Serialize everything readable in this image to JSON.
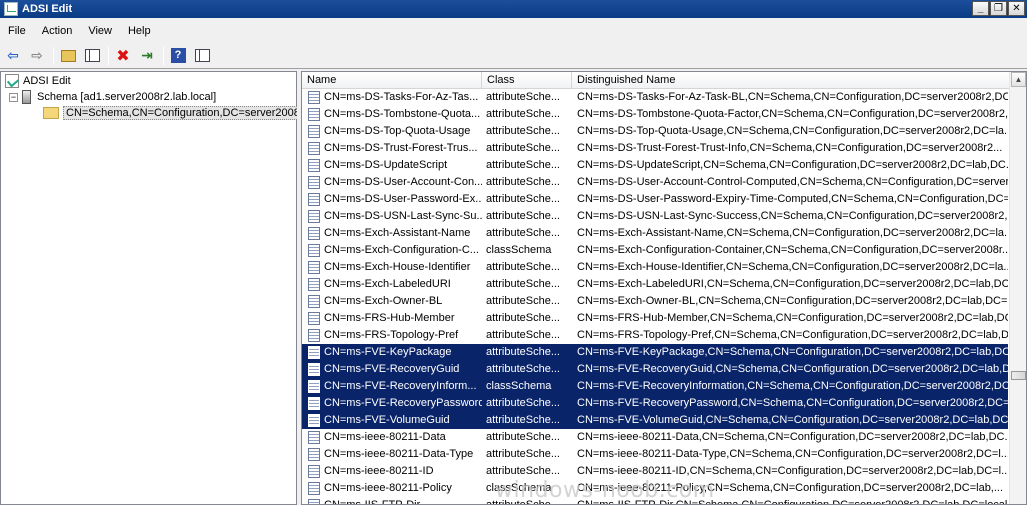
{
  "window": {
    "title": "ADSI Edit",
    "controls": {
      "minimize": "_",
      "restore": "❐",
      "close": "✕"
    }
  },
  "menu": [
    "File",
    "Action",
    "View",
    "Help"
  ],
  "toolbar": [
    {
      "name": "back-arrow-icon",
      "glyph": "⇦"
    },
    {
      "name": "forward-arrow-icon",
      "glyph": "⇨"
    },
    {
      "name": "up-folder-icon",
      "glyph": ""
    },
    {
      "name": "show-hide-tree-icon",
      "glyph": ""
    },
    {
      "name": "delete-icon",
      "glyph": "✖"
    },
    {
      "name": "export-icon",
      "glyph": "⇥"
    },
    {
      "name": "help-icon",
      "glyph": "?"
    },
    {
      "name": "properties-icon",
      "glyph": ""
    }
  ],
  "tree": {
    "root": "ADSI Edit",
    "schema_node": "Schema [ad1.server2008r2.lab.local]",
    "expander": "−",
    "selected_node": "CN=Schema,CN=Configuration,DC=server2008"
  },
  "list": {
    "columns": [
      "Name",
      "Class",
      "Distinguished Name"
    ],
    "rows": [
      {
        "name": "CN=ms-DS-Tasks-For-Az-Tas...",
        "class": "attributeSche...",
        "dn": "CN=ms-DS-Tasks-For-Az-Task-BL,CN=Schema,CN=Configuration,DC=server2008r2,DC...",
        "selected": false
      },
      {
        "name": "CN=ms-DS-Tombstone-Quota...",
        "class": "attributeSche...",
        "dn": "CN=ms-DS-Tombstone-Quota-Factor,CN=Schema,CN=Configuration,DC=server2008r2,D...",
        "selected": false
      },
      {
        "name": "CN=ms-DS-Top-Quota-Usage",
        "class": "attributeSche...",
        "dn": "CN=ms-DS-Top-Quota-Usage,CN=Schema,CN=Configuration,DC=server2008r2,DC=la...",
        "selected": false
      },
      {
        "name": "CN=ms-DS-Trust-Forest-Trus...",
        "class": "attributeSche...",
        "dn": "CN=ms-DS-Trust-Forest-Trust-Info,CN=Schema,CN=Configuration,DC=server2008r2...",
        "selected": false
      },
      {
        "name": "CN=ms-DS-UpdateScript",
        "class": "attributeSche...",
        "dn": "CN=ms-DS-UpdateScript,CN=Schema,CN=Configuration,DC=server2008r2,DC=lab,DC...",
        "selected": false
      },
      {
        "name": "CN=ms-DS-User-Account-Con...",
        "class": "attributeSche...",
        "dn": "CN=ms-DS-User-Account-Control-Computed,CN=Schema,CN=Configuration,DC=server...",
        "selected": false
      },
      {
        "name": "CN=ms-DS-User-Password-Ex...",
        "class": "attributeSche...",
        "dn": "CN=ms-DS-User-Password-Expiry-Time-Computed,CN=Schema,CN=Configuration,DC=s...",
        "selected": false
      },
      {
        "name": "CN=ms-DS-USN-Last-Sync-Su...",
        "class": "attributeSche...",
        "dn": "CN=ms-DS-USN-Last-Sync-Success,CN=Schema,CN=Configuration,DC=server2008r2,...",
        "selected": false
      },
      {
        "name": "CN=ms-Exch-Assistant-Name",
        "class": "attributeSche...",
        "dn": "CN=ms-Exch-Assistant-Name,CN=Schema,CN=Configuration,DC=server2008r2,DC=la...",
        "selected": false
      },
      {
        "name": "CN=ms-Exch-Configuration-C...",
        "class": "classSchema",
        "dn": "CN=ms-Exch-Configuration-Container,CN=Schema,CN=Configuration,DC=server2008r...",
        "selected": false
      },
      {
        "name": "CN=ms-Exch-House-Identifier",
        "class": "attributeSche...",
        "dn": "CN=ms-Exch-House-Identifier,CN=Schema,CN=Configuration,DC=server2008r2,DC=la...",
        "selected": false
      },
      {
        "name": "CN=ms-Exch-LabeledURI",
        "class": "attributeSche...",
        "dn": "CN=ms-Exch-LabeledURI,CN=Schema,CN=Configuration,DC=server2008r2,DC=lab,DC...",
        "selected": false
      },
      {
        "name": "CN=ms-Exch-Owner-BL",
        "class": "attributeSche...",
        "dn": "CN=ms-Exch-Owner-BL,CN=Schema,CN=Configuration,DC=server2008r2,DC=lab,DC=l...",
        "selected": false
      },
      {
        "name": "CN=ms-FRS-Hub-Member",
        "class": "attributeSche...",
        "dn": "CN=ms-FRS-Hub-Member,CN=Schema,CN=Configuration,DC=server2008r2,DC=lab,DC...",
        "selected": false
      },
      {
        "name": "CN=ms-FRS-Topology-Pref",
        "class": "attributeSche...",
        "dn": "CN=ms-FRS-Topology-Pref,CN=Schema,CN=Configuration,DC=server2008r2,DC=lab,D...",
        "selected": false
      },
      {
        "name": "CN=ms-FVE-KeyPackage",
        "class": "attributeSche...",
        "dn": "CN=ms-FVE-KeyPackage,CN=Schema,CN=Configuration,DC=server2008r2,DC=lab,DC...",
        "selected": true
      },
      {
        "name": "CN=ms-FVE-RecoveryGuid",
        "class": "attributeSche...",
        "dn": "CN=ms-FVE-RecoveryGuid,CN=Schema,CN=Configuration,DC=server2008r2,DC=lab,D...",
        "selected": true
      },
      {
        "name": "CN=ms-FVE-RecoveryInform...",
        "class": "classSchema",
        "dn": "CN=ms-FVE-RecoveryInformation,CN=Schema,CN=Configuration,DC=server2008r2,DC...",
        "selected": true
      },
      {
        "name": "CN=ms-FVE-RecoveryPassword",
        "class": "attributeSche...",
        "dn": "CN=ms-FVE-RecoveryPassword,CN=Schema,CN=Configuration,DC=server2008r2,DC=l...",
        "selected": true
      },
      {
        "name": "CN=ms-FVE-VolumeGuid",
        "class": "attributeSche...",
        "dn": "CN=ms-FVE-VolumeGuid,CN=Schema,CN=Configuration,DC=server2008r2,DC=lab,DC=...",
        "selected": true
      },
      {
        "name": "CN=ms-ieee-80211-Data",
        "class": "attributeSche...",
        "dn": "CN=ms-ieee-80211-Data,CN=Schema,CN=Configuration,DC=server2008r2,DC=lab,DC...",
        "selected": false
      },
      {
        "name": "CN=ms-ieee-80211-Data-Type",
        "class": "attributeSche...",
        "dn": "CN=ms-ieee-80211-Data-Type,CN=Schema,CN=Configuration,DC=server2008r2,DC=l...",
        "selected": false
      },
      {
        "name": "CN=ms-ieee-80211-ID",
        "class": "attributeSche...",
        "dn": "CN=ms-ieee-80211-ID,CN=Schema,CN=Configuration,DC=server2008r2,DC=lab,DC=l...",
        "selected": false
      },
      {
        "name": "CN=ms-ieee-80211-Policy",
        "class": "classSchema",
        "dn": "CN=ms-ieee-80211-Policy,CN=Schema,CN=Configuration,DC=server2008r2,DC=lab,...",
        "selected": false
      },
      {
        "name": "CN=ms-IIS-FTP-Dir",
        "class": "attributeSche...",
        "dn": "CN=ms-IIS-FTP-Dir,CN=Schema,CN=Configuration,DC=server2008r2,DC=lab,DC=local",
        "selected": false
      }
    ],
    "scrollbar": {
      "up": "▲",
      "down": "▼"
    }
  },
  "watermark": "windows-noob.com",
  "colors": {
    "selection": "#0a246a",
    "titlebar": "#0a3a84"
  }
}
